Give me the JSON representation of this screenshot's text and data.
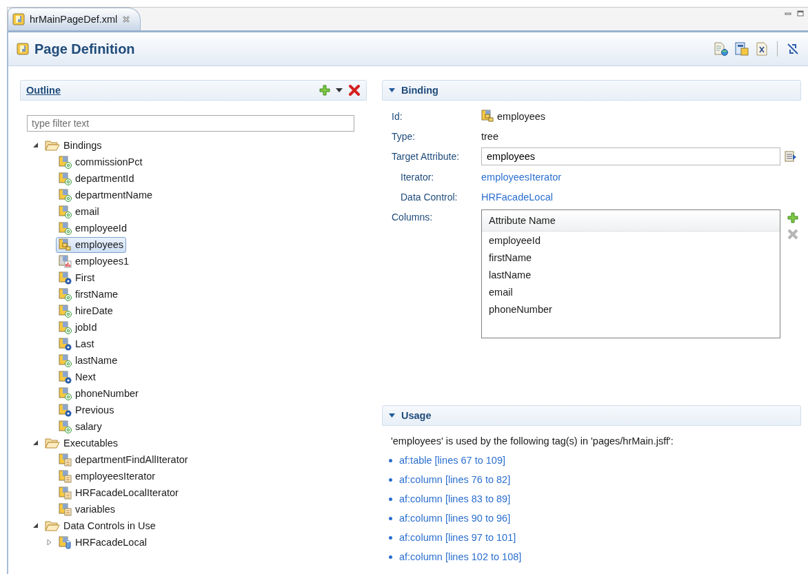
{
  "editor_tab": {
    "title": "hrMainPageDef.xml",
    "selected": true
  },
  "page": {
    "title": "Page Definition"
  },
  "outline": {
    "title": "Outline",
    "filter_placeholder": "type filter text",
    "tree": [
      {
        "label": "Bindings",
        "kind": "folder",
        "expanded": true,
        "selected": false,
        "children": [
          {
            "label": "commissionPct",
            "kind": "attribute",
            "selected": false
          },
          {
            "label": "departmentId",
            "kind": "attribute",
            "selected": false
          },
          {
            "label": "departmentName",
            "kind": "attribute",
            "selected": false
          },
          {
            "label": "email",
            "kind": "attribute",
            "selected": false
          },
          {
            "label": "employeeId",
            "kind": "attribute",
            "selected": false
          },
          {
            "label": "employees",
            "kind": "tree",
            "selected": true
          },
          {
            "label": "employees1",
            "kind": "graph",
            "selected": false
          },
          {
            "label": "First",
            "kind": "action",
            "selected": false
          },
          {
            "label": "firstName",
            "kind": "attribute",
            "selected": false
          },
          {
            "label": "hireDate",
            "kind": "attribute",
            "selected": false
          },
          {
            "label": "jobId",
            "kind": "attribute",
            "selected": false
          },
          {
            "label": "Last",
            "kind": "action",
            "selected": false
          },
          {
            "label": "lastName",
            "kind": "attribute",
            "selected": false
          },
          {
            "label": "Next",
            "kind": "action",
            "selected": false
          },
          {
            "label": "phoneNumber",
            "kind": "attribute",
            "selected": false
          },
          {
            "label": "Previous",
            "kind": "action",
            "selected": false
          },
          {
            "label": "salary",
            "kind": "attribute",
            "selected": false
          }
        ]
      },
      {
        "label": "Executables",
        "kind": "folder",
        "expanded": true,
        "selected": false,
        "children": [
          {
            "label": "departmentFindAllIterator",
            "kind": "iterator",
            "selected": false
          },
          {
            "label": "employeesIterator",
            "kind": "iterator",
            "selected": false
          },
          {
            "label": "HRFacadeLocalIterator",
            "kind": "iterator",
            "selected": false
          },
          {
            "label": "variables",
            "kind": "iterator",
            "selected": false
          }
        ]
      },
      {
        "label": "Data Controls in Use",
        "kind": "folder",
        "expanded": true,
        "selected": false,
        "children": [
          {
            "label": "HRFacadeLocal",
            "kind": "datacontrol",
            "expanded": false,
            "selected": false
          }
        ]
      }
    ]
  },
  "binding": {
    "title": "Binding",
    "expanded": true,
    "id_label": "Id:",
    "id_value": "employees",
    "type_label": "Type:",
    "type_value": "tree",
    "target_label": "Target Attribute:",
    "target_value": "employees",
    "iterator_label": "Iterator:",
    "iterator_value": "employeesIterator",
    "data_control_label": "Data Control:",
    "data_control_value": "HRFacadeLocal",
    "columns_label": "Columns:",
    "columns_table": {
      "header": "Attribute Name",
      "rows": [
        "employeeId",
        "firstName",
        "lastName",
        "email",
        "phoneNumber"
      ]
    },
    "column_buttons": [
      {
        "kind": "add",
        "disabled": false
      },
      {
        "kind": "remove",
        "disabled": true
      }
    ]
  },
  "usage": {
    "title": "Usage",
    "expanded": true,
    "intro": "'employees' is used by the following tag(s) in 'pages/hrMain.jsff':",
    "links": [
      "af:table [lines 67 to 109]",
      "af:column [lines 76 to 82]",
      "af:column [lines 83 to 89]",
      "af:column [lines 90 to 96]",
      "af:column [lines 97 to 101]",
      "af:column [lines 102 to 108]"
    ]
  }
}
